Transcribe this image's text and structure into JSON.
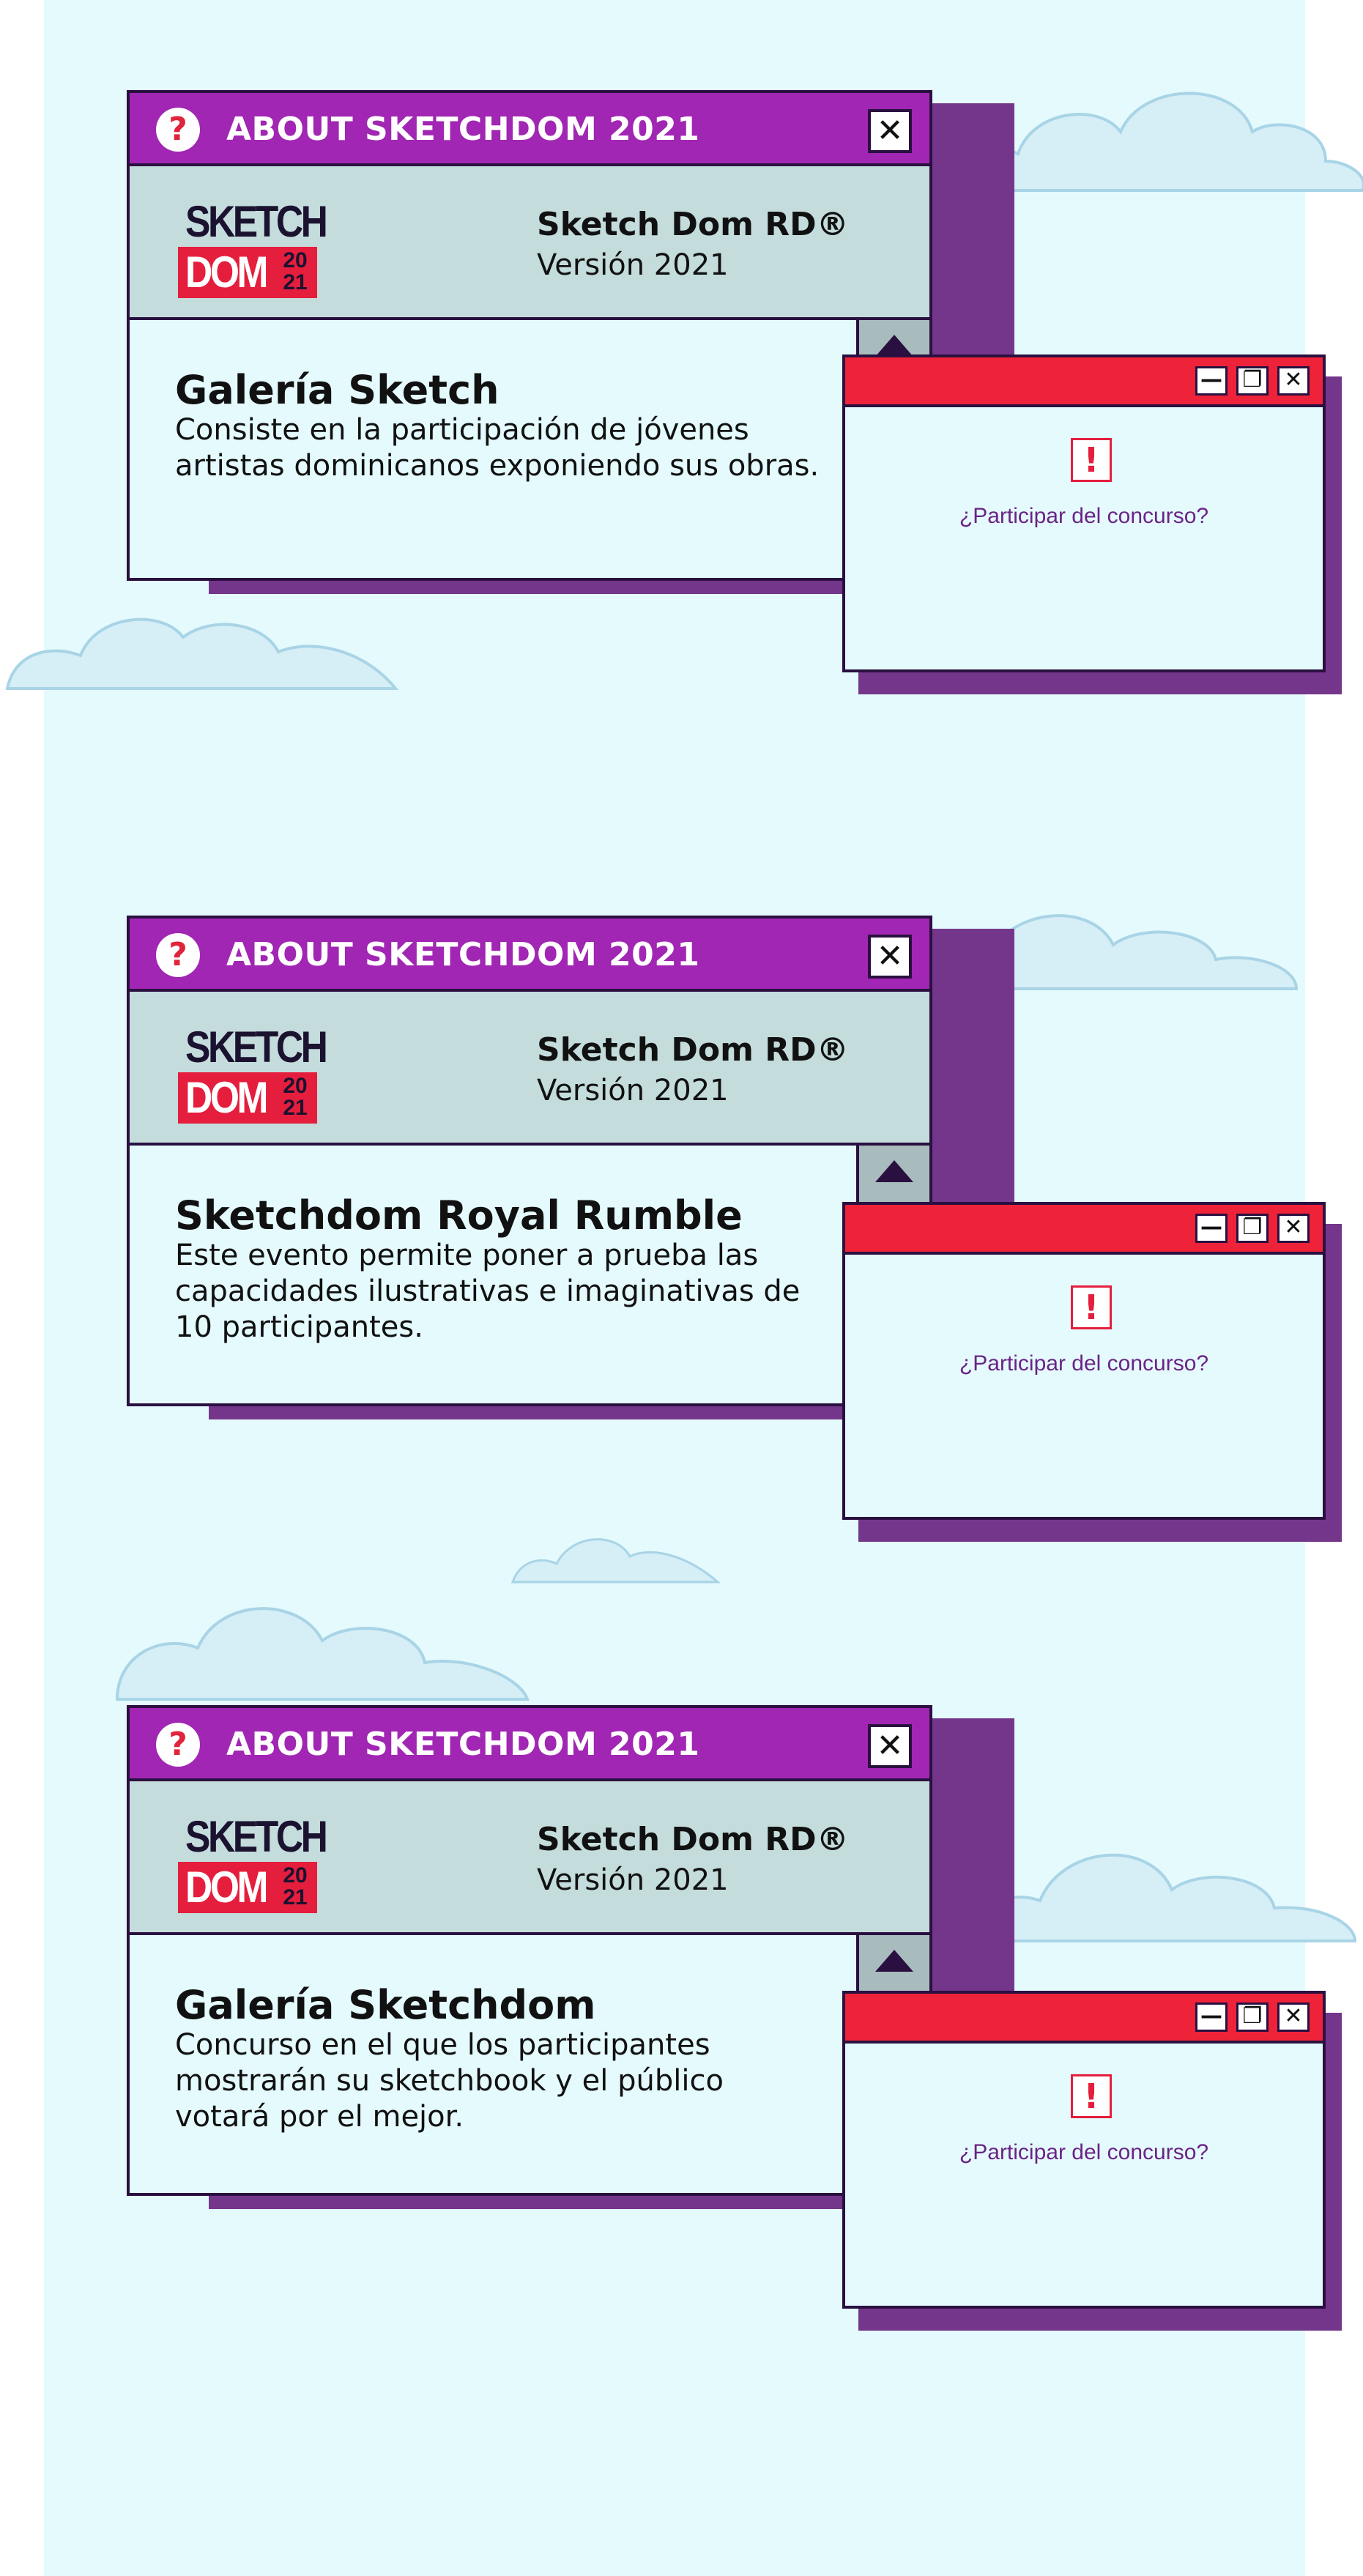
{
  "windows": [
    {
      "title": "ABOUT SKETCHDOM 2021",
      "product": "Sketch Dom RD®",
      "version": "Versión 2021",
      "heading": "Galería Sketch",
      "description": "Consiste en la participación de jóvenes artistas dominicanos exponiendo sus obras.",
      "alert_question": "¿Participar del concurso?"
    },
    {
      "title": "ABOUT SKETCHDOM 2021",
      "product": "Sketch Dom RD®",
      "version": "Versión 2021",
      "heading": "Sketchdom Royal Rumble",
      "description": "Este evento permite poner a prueba las capacidades ilustrativas e imaginativas de 10 participantes.",
      "alert_question": "¿Participar del concurso?"
    },
    {
      "title": "ABOUT SKETCHDOM 2021",
      "product": "Sketch Dom RD®",
      "version": "Versión 2021",
      "heading": "Galería Sketchdom",
      "description": "Concurso en el que los participantes mostrarán su sketchbook y el público votará por el mejor.",
      "alert_question": "¿Participar del concurso?"
    }
  ],
  "logo": {
    "line1": "SKETCH",
    "line2": "DOM",
    "year_top": "20",
    "year_bottom": "21"
  },
  "icons": {
    "help": "question-circle-icon",
    "close": "close-x-icon",
    "minimize": "minimize-icon",
    "restore": "restore-icon",
    "warning": "exclamation-icon",
    "scroll_up": "triangle-up-icon",
    "scroll_down": "triangle-down-icon"
  },
  "glyphs": {
    "help": "?",
    "close": "✕",
    "minimize": "—",
    "restore": "❐",
    "warning": "!"
  },
  "colors": {
    "background": "#e4fafd",
    "about_titlebar": "#a126b3",
    "alert_titlebar": "#ee2339",
    "shadow": "#74368b",
    "infobar": "#c4dcdc",
    "border": "#2a1040",
    "brand_red": "#e51e3d"
  }
}
